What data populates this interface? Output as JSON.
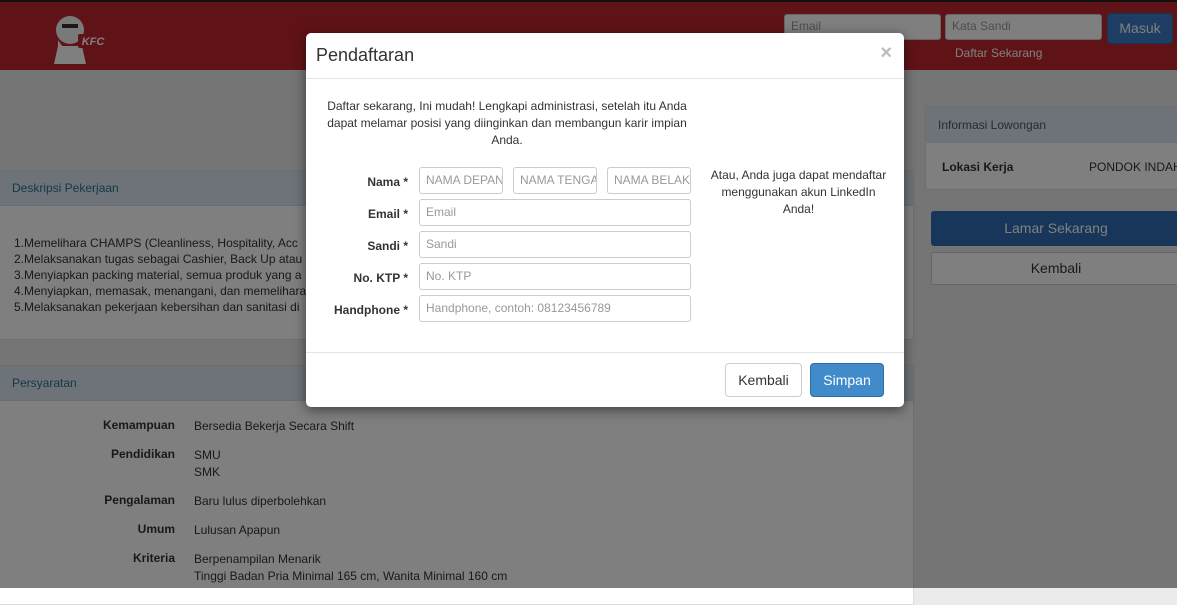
{
  "header": {
    "logo_text": "KFC",
    "email_placeholder": "Email",
    "password_placeholder": "Kata Sandi",
    "login_label": "Masuk",
    "register_link": "Daftar Sekarang"
  },
  "job": {
    "description_title": "Deskripsi Pekerjaan",
    "description_items": [
      "1.Memelihara CHAMPS (Cleanliness, Hospitality, Acc",
      "2.Melaksanakan tugas sebagai Cashier, Back Up atau",
      "3.Menyiapkan packing material, semua produk yang a",
      "4.Menyiapkan, memasak, menangani, dan memelihara",
      "5.Melaksanakan pekerjaan kebersihan dan sanitasi di"
    ],
    "requirements_title": "Persyaratan",
    "requirements": [
      {
        "label": "Kemampuan",
        "values": [
          "Bersedia Bekerja Secara Shift"
        ]
      },
      {
        "label": "Pendidikan",
        "values": [
          "SMU",
          "SMK"
        ]
      },
      {
        "label": "Pengalaman",
        "values": [
          "Baru lulus diperbolehkan"
        ]
      },
      {
        "label": "Umum",
        "values": [
          "Lulusan Apapun"
        ]
      },
      {
        "label": "Kriteria",
        "values": [
          "Berpenampilan Menarik",
          "Tinggi Badan Pria Minimal 165 cm, Wanita Minimal 160 cm"
        ]
      }
    ]
  },
  "sidebar": {
    "info_title": "Informasi Lowongan",
    "location_label": "Lokasi Kerja",
    "location_value": "PONDOK INDAH",
    "apply_label": "Lamar Sekarang",
    "back_label": "Kembali"
  },
  "modal": {
    "title": "Pendaftaran",
    "close": "×",
    "intro": "Daftar sekarang, Ini mudah! Lengkapi administrasi, setelah itu Anda dapat melamar posisi yang diinginkan dan membangun karir impian Anda.",
    "linkedin_text": "Atau, Anda juga dapat mendaftar menggunakan akun LinkedIn Anda!",
    "labels": {
      "name": "Nama *",
      "email": "Email *",
      "password": "Sandi *",
      "ktp": "No. KTP *",
      "phone": "Handphone *"
    },
    "placeholders": {
      "first_name": "NAMA DEPAN",
      "middle_name": "NAMA TENGAH",
      "last_name": "NAMA BELAKANG",
      "email": "Email",
      "password": "Sandi",
      "ktp": "No. KTP",
      "phone": "Handphone, contoh: 08123456789"
    },
    "back_label": "Kembali",
    "save_label": "Simpan"
  }
}
